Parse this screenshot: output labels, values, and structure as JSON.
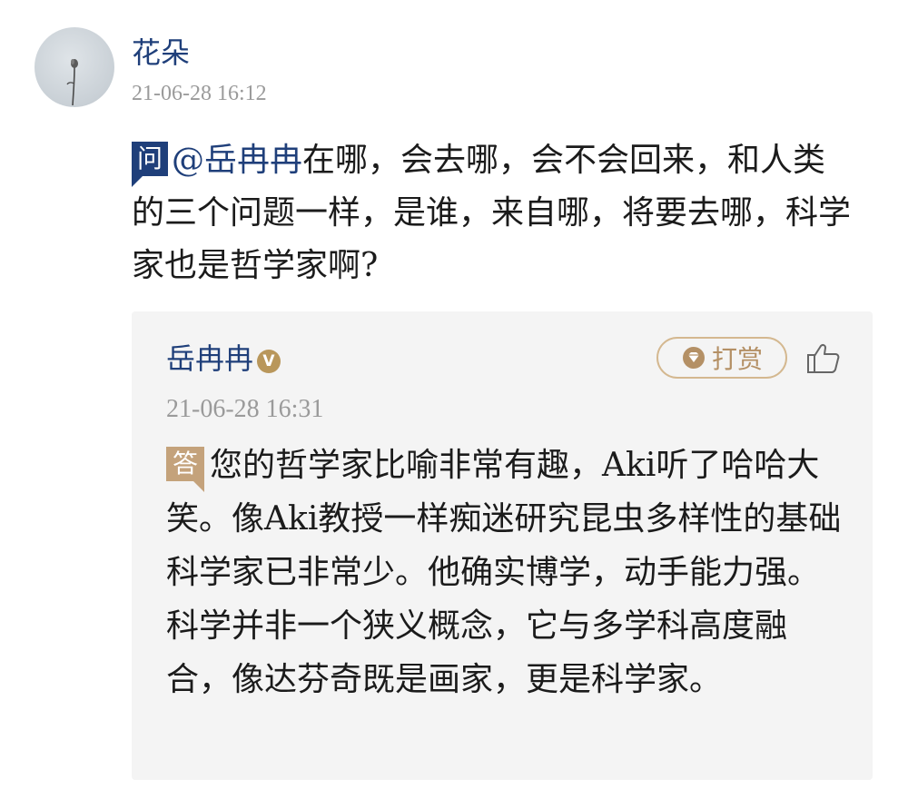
{
  "question": {
    "author": "花朵",
    "timestamp": "21-06-28 16:12",
    "tag": "问",
    "mention": "@岳冉冉",
    "text": "在哪，会去哪，会不会回来，和人类的三个问题一样，是谁，来自哪，将要去哪，科学家也是哲学家啊?"
  },
  "reply": {
    "author": "岳冉冉",
    "verified_badge": "V",
    "tip_label": "打赏",
    "timestamp": "21-06-28 16:31",
    "tag": "答",
    "text": "您的哲学家比喻非常有趣，Aki听了哈哈大笑。像Aki教授一样痴迷研究昆虫多样性的基础科学家已非常少。他确实博学，动手能力强。科学并非一个狭义概念，它与多学科高度融合，像达芬奇既是画家，更是科学家。"
  },
  "icons": {
    "avatar": "flower-avatar",
    "tip": "gem-icon",
    "like": "thumbs-up-icon"
  },
  "colors": {
    "name_blue": "#1f3f7a",
    "answer_tag": "#c4a27b",
    "tip_border": "#d4b890",
    "reply_bg": "#f4f4f4"
  }
}
